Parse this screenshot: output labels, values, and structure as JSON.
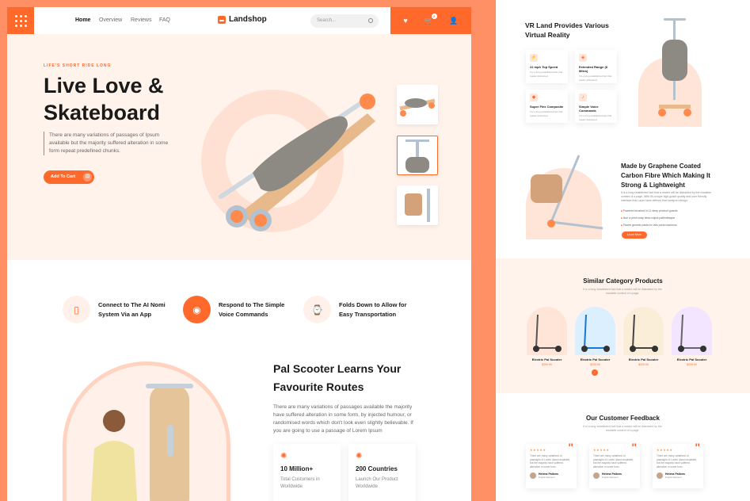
{
  "header": {
    "nav": [
      "Home",
      "Overview",
      "Reviews",
      "FAQ"
    ],
    "brand": "Landshop",
    "search_placeholder": "Search...",
    "cart_count": "2"
  },
  "hero": {
    "tagline": "LIFE'S SHORT RIDE LONG",
    "title": "Live Love & Skateboard",
    "description": "There are many variations of passages of Ipsum available but the majority suffered alteration in some form repeat predefined chunks.",
    "cta": "Add To Cart"
  },
  "features": [
    {
      "label": "Connect to The AI Nomi System Via an App",
      "icon": "phone-icon"
    },
    {
      "label": "Respond to The Simple Voice Commands",
      "icon": "microphone-icon"
    },
    {
      "label": "Folds Down to Allow for Easy Transportation",
      "icon": "watch-icon"
    }
  ],
  "routes": {
    "title": "Pal Scooter Learns Your Favourite Routes",
    "description": "There are many variations of passages available the majority have suffered alteration in some form, by injected humour, or randomised words which don't look even slightly believable. If you are going to use a passage of Lorem Ipsum",
    "stats": [
      {
        "value": "10 Million+",
        "label": "Total Customers in Worldwide"
      },
      {
        "value": "200 Countries",
        "label": "Launch Our Product Worldwide"
      }
    ]
  },
  "right": {
    "vr_title": "VR Land Provides Various Virtual Reality",
    "vr_cards": [
      {
        "title": "22 mph Top Speed",
        "desc": "It is a long established fact that reader distracted."
      },
      {
        "title": "Extended Range (8 Miles)",
        "desc": "It is a long established fact that reader distracted."
      },
      {
        "title": "Super Flex Composite",
        "desc": "It is a long established fact that reader distracted."
      },
      {
        "title": "Simple Voice Commands",
        "desc": "It is a long established fact that reader distracted."
      }
    ],
    "made_title": "Made by Graphene Coated Carbon Fibre Which Making It Strong & Lightweight",
    "made_desc": "It is a long established fact that a reader will be distracted by the readable content of a page. With it's unique high-grade quality and user friendly interface that Layer have defined that transport design.",
    "made_bullets": [
      "Powered brushed in 11 deep product guards",
      "Ikon a print-snap beta-output pallentesque",
      "Places genetic pasta ex vitis porta maximus"
    ],
    "learn_more": "Learn More",
    "similar_title": "Similar Category Products",
    "similar_sub": "It is a long established fact that a reader will be distracted by the readable content of a page.",
    "products": [
      {
        "name": "Electric Pal Scooter",
        "price": "$209.99",
        "bg": "#ffe4d8"
      },
      {
        "name": "Electric Pal Scooter",
        "price": "$209.99",
        "bg": "#dcefff"
      },
      {
        "name": "Electric Pal Scooter",
        "price": "$209.99",
        "bg": "#fbeed8"
      },
      {
        "name": "Electric Pal Scooter",
        "price": "$209.99",
        "bg": "#f3e4ff"
      }
    ],
    "feedback_title": "Our Customer Feedback",
    "feedback_sub": "It is a long established fact that a reader will be distracted by the readable content of a page.",
    "reviews": [
      {
        "stars": "★★★★★",
        "text": "There are many variations of passages of Lorem Ipsum available, but the majority have suffered alteration in some form.",
        "name": "Helena Pallons",
        "role": "Digital Marketer"
      },
      {
        "stars": "★★★★★",
        "text": "There are many variations of passages of Lorem Ipsum available, but the majority have suffered alteration in some form.",
        "name": "Helena Pallons",
        "role": "Digital Marketer"
      },
      {
        "stars": "★★★★★",
        "text": "There are many variations of passages of Lorem Ipsum available, but the majority have suffered alteration in some form.",
        "name": "Helena Pallons",
        "role": "Digital Marketer"
      }
    ]
  },
  "colors": {
    "accent": "#ff6a2c",
    "page_bg": "#ff8f65",
    "hero_bg": "#fff3ec"
  }
}
